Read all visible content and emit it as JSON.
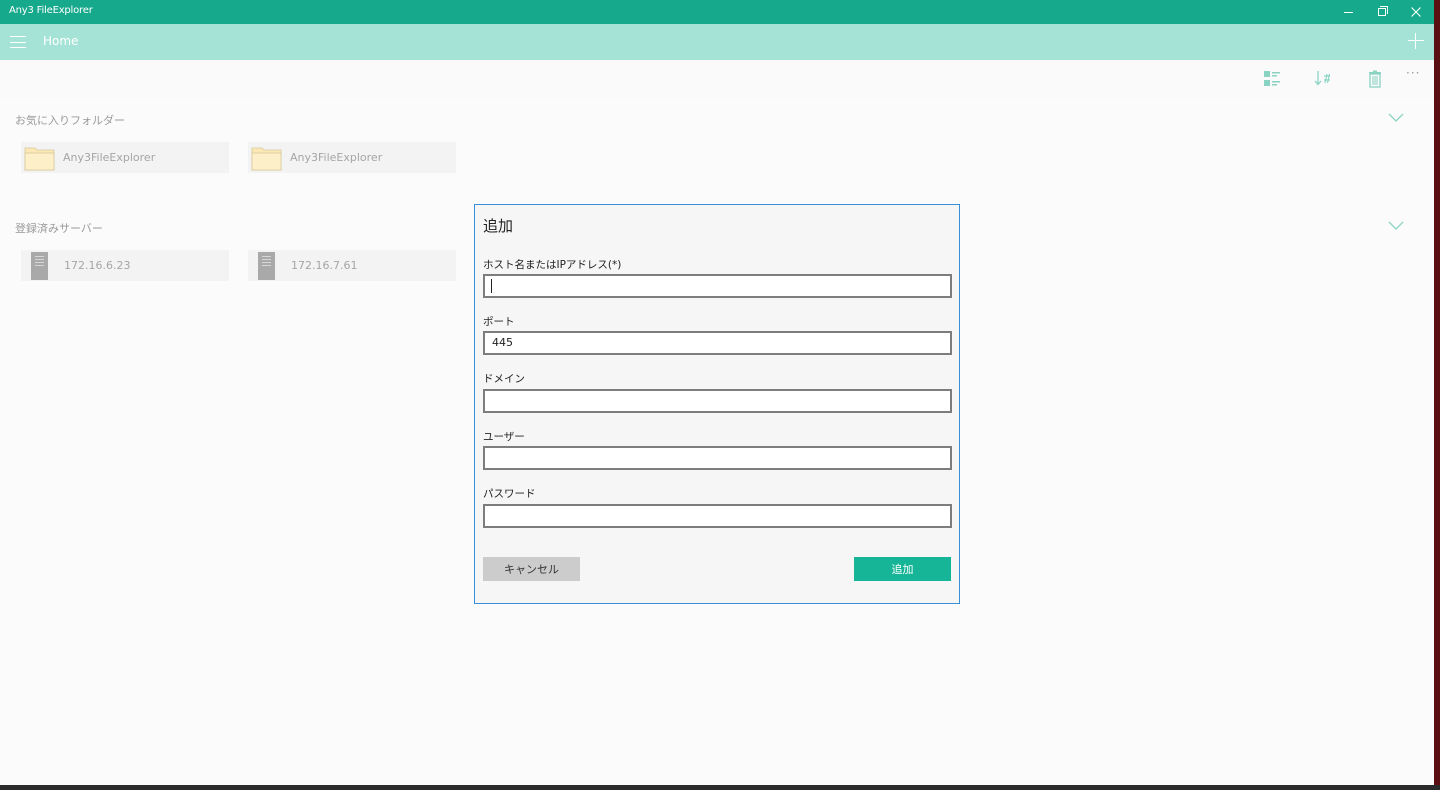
{
  "window": {
    "title": "Any3 FileExplorer",
    "controls": [
      "minimize-icon",
      "restore-icon",
      "close-icon"
    ]
  },
  "header": {
    "menu_icon": "hamburger-icon",
    "title": "Home",
    "add_icon": "plus-icon"
  },
  "toolbar": {
    "icons": [
      "view-list-icon",
      "sort-icon",
      "trash-icon",
      "more-icon"
    ],
    "more_label": "···"
  },
  "favorites": {
    "title": "お気に入りフォルダー",
    "items": [
      {
        "label": "Any3FileExplorer",
        "icon": "folder-icon"
      },
      {
        "label": "Any3FileExplorer",
        "icon": "folder-icon"
      }
    ]
  },
  "servers": {
    "title": "登録済みサーバー",
    "items": [
      {
        "label": "172.16.6.23",
        "icon": "server-icon"
      },
      {
        "label": "172.16.7.61",
        "icon": "server-icon"
      }
    ]
  },
  "dialog": {
    "title": "追加",
    "fields": [
      {
        "label": "ホスト名またはIPアドレス(*)",
        "value": ""
      },
      {
        "label": "ポート",
        "value": "445"
      },
      {
        "label": "ドメイン",
        "value": ""
      },
      {
        "label": "ユーザー",
        "value": ""
      },
      {
        "label": "パスワード",
        "value": ""
      }
    ],
    "cancel_label": "キャンセル",
    "add_label": "追加"
  },
  "colors": {
    "titlebar": "#17a98c",
    "appbar": "#a4e3d6",
    "accent": "#17b597",
    "dialog_border": "#3a8fd9"
  }
}
